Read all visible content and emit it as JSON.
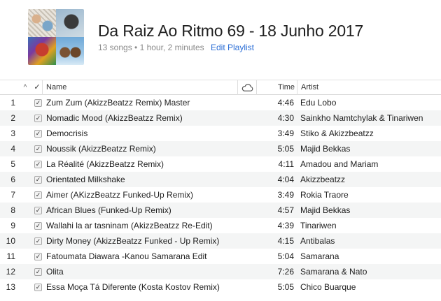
{
  "playlist": {
    "title": "Da Raiz Ao Ritmo 69 - 18 Junho 2017",
    "summary": "13 songs • 1 hour, 2 minutes",
    "edit_label": "Edit Playlist"
  },
  "columns": {
    "sort_arrow": "^",
    "check": "✓",
    "name": "Name",
    "cloud_icon": "cloud-icon",
    "time": "Time",
    "artist": "Artist"
  },
  "tracks": [
    {
      "num": "1",
      "checked": "✓",
      "name": "Zum Zum (AkizzBeatzz Remix) Master",
      "time": "4:46",
      "artist": "Edu Lobo"
    },
    {
      "num": "2",
      "checked": "✓",
      "name": "Nomadic Mood (AkizzBeatzz Remix)",
      "time": "4:30",
      "artist": "Sainkho Namtchylak & Tinariwen"
    },
    {
      "num": "3",
      "checked": "✓",
      "name": "Democrisis",
      "time": "3:49",
      "artist": "Stiko & Akizzbeatzz"
    },
    {
      "num": "4",
      "checked": "✓",
      "name": "Noussik (AkizzBeatzz Remix)",
      "time": "5:05",
      "artist": "Majid Bekkas"
    },
    {
      "num": "5",
      "checked": "✓",
      "name": "La Réalité (AkizzBeatzz Remix)",
      "time": "4:11",
      "artist": "Amadou and Mariam"
    },
    {
      "num": "6",
      "checked": "✓",
      "name": "Orientated Milkshake",
      "time": "4:04",
      "artist": "Akizzbeatzz"
    },
    {
      "num": "7",
      "checked": "✓",
      "name": "Aimer (AKizzBeatzz Funked-Up Remix)",
      "time": "3:49",
      "artist": "Rokia Traore"
    },
    {
      "num": "8",
      "checked": "✓",
      "name": "African Blues (Funked-Up Remix)",
      "time": "4:57",
      "artist": "Majid Bekkas"
    },
    {
      "num": "9",
      "checked": "✓",
      "name": "Wallahi la ar tasninam (AkizzBeatzz Re-Edit)",
      "time": "4:39",
      "artist": "Tinariwen"
    },
    {
      "num": "10",
      "checked": "✓",
      "name": "Dirty Money (AkizzBeatzz Funked - Up Remix)",
      "time": "4:15",
      "artist": "Antibalas"
    },
    {
      "num": "11",
      "checked": "✓",
      "name": "Fatoumata Diawara -Kanou Samarana Edit",
      "time": "5:04",
      "artist": "Samarana"
    },
    {
      "num": "12",
      "checked": "✓",
      "name": "Olita",
      "time": "7:26",
      "artist": "Samarana & Nato"
    },
    {
      "num": "13",
      "checked": "✓",
      "name": "Essa Moça Tá Diferente (Kosta Kostov Remix)",
      "time": "5:05",
      "artist": "Chico Buarque"
    }
  ]
}
